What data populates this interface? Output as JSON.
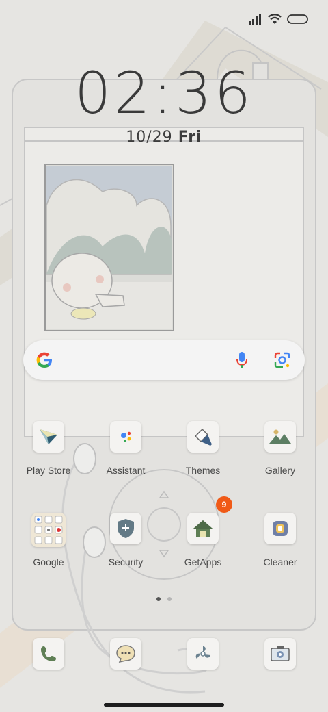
{
  "status_bar": {
    "signal_icon": "signal-icon",
    "wifi_icon": "wifi-icon",
    "battery_icon": "battery-icon"
  },
  "lockclock": {
    "time": "02:36",
    "date": "10/29",
    "day": "Fri"
  },
  "search": {
    "logo": "google-g-logo",
    "mic_icon": "mic-icon",
    "lens_icon": "lens-icon"
  },
  "apps": [
    {
      "label": "Play Store",
      "icon": "play-store-icon"
    },
    {
      "label": "Assistant",
      "icon": "assistant-icon"
    },
    {
      "label": "Themes",
      "icon": "themes-icon"
    },
    {
      "label": "Gallery",
      "icon": "gallery-icon"
    },
    {
      "label": "Google",
      "icon": "google-folder-icon"
    },
    {
      "label": "Security",
      "icon": "security-icon"
    },
    {
      "label": "GetApps",
      "icon": "getapps-icon",
      "badge": "9"
    },
    {
      "label": "Cleaner",
      "icon": "cleaner-icon"
    }
  ],
  "pager": {
    "pages": 2,
    "active": 1
  },
  "dock": [
    "phone-icon",
    "messaging-icon",
    "browser-icon",
    "camera-icon"
  ],
  "colors": {
    "background": "#e6e5e2",
    "badge": "#f05a17",
    "text": "#4a4a4a"
  }
}
